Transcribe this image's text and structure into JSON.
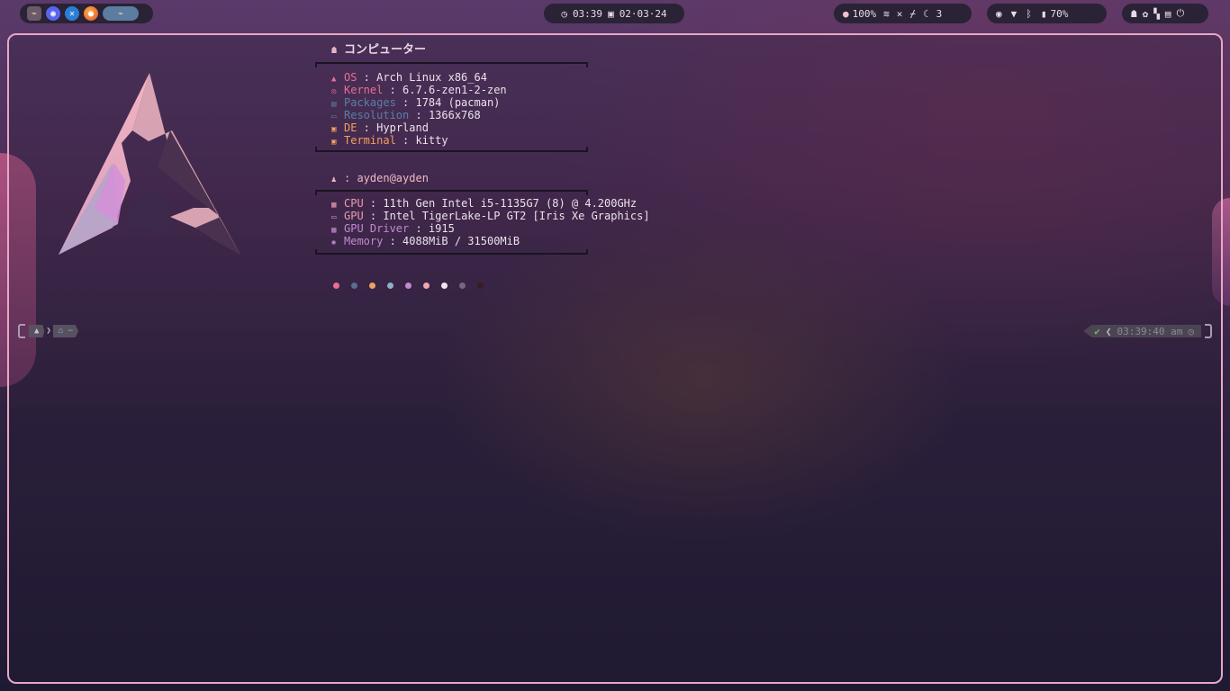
{
  "topbar": {
    "apps": [
      {
        "name": "kitty",
        "glyph": "⌁"
      },
      {
        "name": "discord",
        "glyph": "◉"
      },
      {
        "name": "vscode",
        "glyph": "✕"
      },
      {
        "name": "firefox",
        "glyph": "●"
      }
    ],
    "active_workspace_glyph": "⌁",
    "time": "03:39",
    "date": "02·03·24",
    "brightness": "100%",
    "notifications": "3",
    "battery": "70%"
  },
  "fetch": {
    "title": "コンピューター",
    "system": [
      {
        "icon": "▲",
        "key": "OS",
        "value": "Arch Linux x86_64",
        "color": "pink"
      },
      {
        "icon": "◎",
        "key": "Kernel",
        "value": "6.7.6-zen1-2-zen",
        "color": "pink"
      },
      {
        "icon": "▤",
        "key": "Packages",
        "value": "1784 (pacman)",
        "color": "blue"
      },
      {
        "icon": "▭",
        "key": "Resolution",
        "value": "1366x768",
        "color": "blue"
      },
      {
        "icon": "▣",
        "key": "DE",
        "value": "Hyprland",
        "color": "orange"
      },
      {
        "icon": "▣",
        "key": "Terminal",
        "value": "kitty",
        "color": "orange"
      }
    ],
    "user": "ayden@ayden",
    "hardware": [
      {
        "icon": "▦",
        "key": "CPU",
        "value": "11th Gen Intel i5-1135G7 (8) @ 4.200GHz",
        "color": "peach"
      },
      {
        "icon": "▭",
        "key": "GPU",
        "value": "Intel TigerLake-LP GT2 [Iris Xe Graphics]",
        "color": "peach"
      },
      {
        "icon": "▦",
        "key": "GPU Driver",
        "value": "i915",
        "color": "purple"
      },
      {
        "icon": "✺",
        "key": "Memory",
        "value": "4088MiB / 31500MiB",
        "color": "purple"
      }
    ],
    "palette": [
      "#e96e94",
      "#5b6c95",
      "#f0a061",
      "#8fb0c8",
      "#c08ad0",
      "#f0a8b0",
      "#f2e6ee",
      "#7a6580",
      "#3a1d22"
    ]
  },
  "prompt": {
    "left_icon": "▲",
    "left_path": "⌂ ⋯",
    "right_status": "✔",
    "right_time": "03:39:40 am",
    "right_icon": "◷"
  }
}
